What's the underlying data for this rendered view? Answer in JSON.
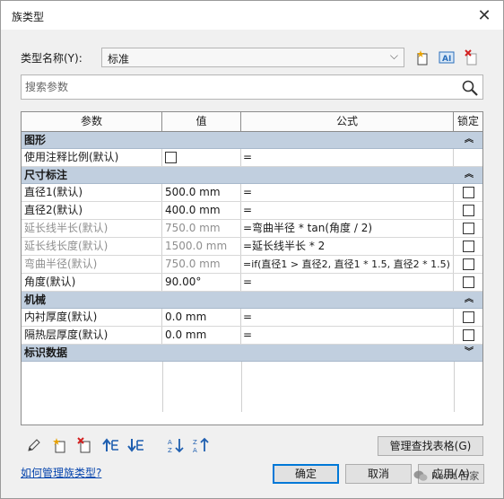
{
  "window": {
    "title": "族类型",
    "close_label": "✕"
  },
  "type_name": {
    "label": "类型名称(Y):",
    "value": "标准"
  },
  "search": {
    "placeholder": "搜索参数"
  },
  "columns": {
    "param": "参数",
    "value": "值",
    "formula": "公式",
    "lock": "锁定"
  },
  "groups": {
    "graphics": "图形",
    "dimensions": "尺寸标注",
    "mechanical": "机械",
    "identity": "标识数据"
  },
  "rows": {
    "graphics": [
      {
        "param": "使用注释比例(默认)",
        "value": "",
        "formula": "=",
        "value_checkbox": true,
        "lock": false
      }
    ],
    "dimensions": [
      {
        "param": "直径1(默认)",
        "value": "500.0 mm",
        "formula": "=",
        "gray": false
      },
      {
        "param": "直径2(默认)",
        "value": "400.0 mm",
        "formula": "=",
        "gray": false
      },
      {
        "param": "延长线半长(默认)",
        "value": "750.0 mm",
        "formula": "=弯曲半径 * tan(角度 / 2)",
        "gray": true
      },
      {
        "param": "延长线长度(默认)",
        "value": "1500.0 mm",
        "formula": "=延长线半长 * 2",
        "gray": true
      },
      {
        "param": "弯曲半径(默认)",
        "value": "750.0 mm",
        "formula": "=if(直径1 > 直径2, 直径1 * 1.5, 直径2 * 1.5)",
        "gray": true
      },
      {
        "param": "角度(默认)",
        "value": "90.00°",
        "formula": "=",
        "gray": false
      }
    ],
    "mechanical": [
      {
        "param": "内衬厚度(默认)",
        "value": "0.0 mm",
        "formula": "="
      },
      {
        "param": "隔热层厚度(默认)",
        "value": "0.0 mm",
        "formula": "="
      }
    ]
  },
  "buttons": {
    "manage_lookup": "管理查找表格(G)",
    "ok": "确定",
    "cancel": "取消",
    "apply": "应用(A)"
  },
  "help_link": "如何管理族类型?",
  "watermark": "Revit 百家"
}
